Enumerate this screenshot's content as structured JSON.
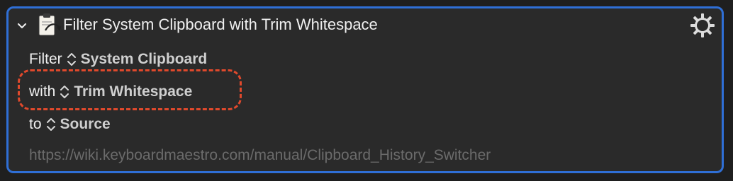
{
  "action": {
    "title": "Filter System Clipboard with Trim Whitespace",
    "icon": "clipboard-filter-icon",
    "expanded": true
  },
  "fields": {
    "filter": {
      "label": "Filter",
      "value": "System Clipboard"
    },
    "with": {
      "label": "with",
      "value": "Trim Whitespace"
    },
    "to": {
      "label": "to",
      "value": "Source"
    }
  },
  "footer": {
    "url": "https://wiki.keyboardmaestro.com/manual/Clipboard_History_Switcher"
  },
  "colors": {
    "focus_border": "#2f6fd6",
    "highlight": "#e0492c",
    "panel_bg": "#2a2a2a"
  }
}
